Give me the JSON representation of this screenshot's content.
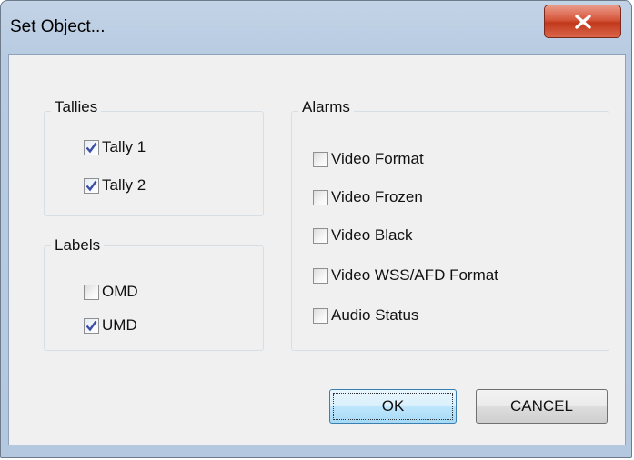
{
  "window": {
    "title": "Set Object...",
    "close_icon": "close-x-icon"
  },
  "tallies": {
    "title": "Tallies",
    "items": [
      {
        "label": "Tally 1",
        "checked": true
      },
      {
        "label": "Tally 2",
        "checked": true
      }
    ]
  },
  "labels": {
    "title": "Labels",
    "items": [
      {
        "label": "OMD",
        "checked": false
      },
      {
        "label": "UMD",
        "checked": true
      }
    ]
  },
  "alarms": {
    "title": "Alarms",
    "items": [
      {
        "label": "Video Format",
        "checked": false
      },
      {
        "label": "Video Frozen",
        "checked": false
      },
      {
        "label": "Video Black",
        "checked": false
      },
      {
        "label": "Video WSS/AFD Format",
        "checked": false
      },
      {
        "label": "Audio Status",
        "checked": false
      }
    ]
  },
  "buttons": {
    "ok_label": "OK",
    "cancel_label": "CANCEL"
  },
  "colors": {
    "checkmark": "#3a4ea8",
    "close_button": "#c7452a"
  }
}
